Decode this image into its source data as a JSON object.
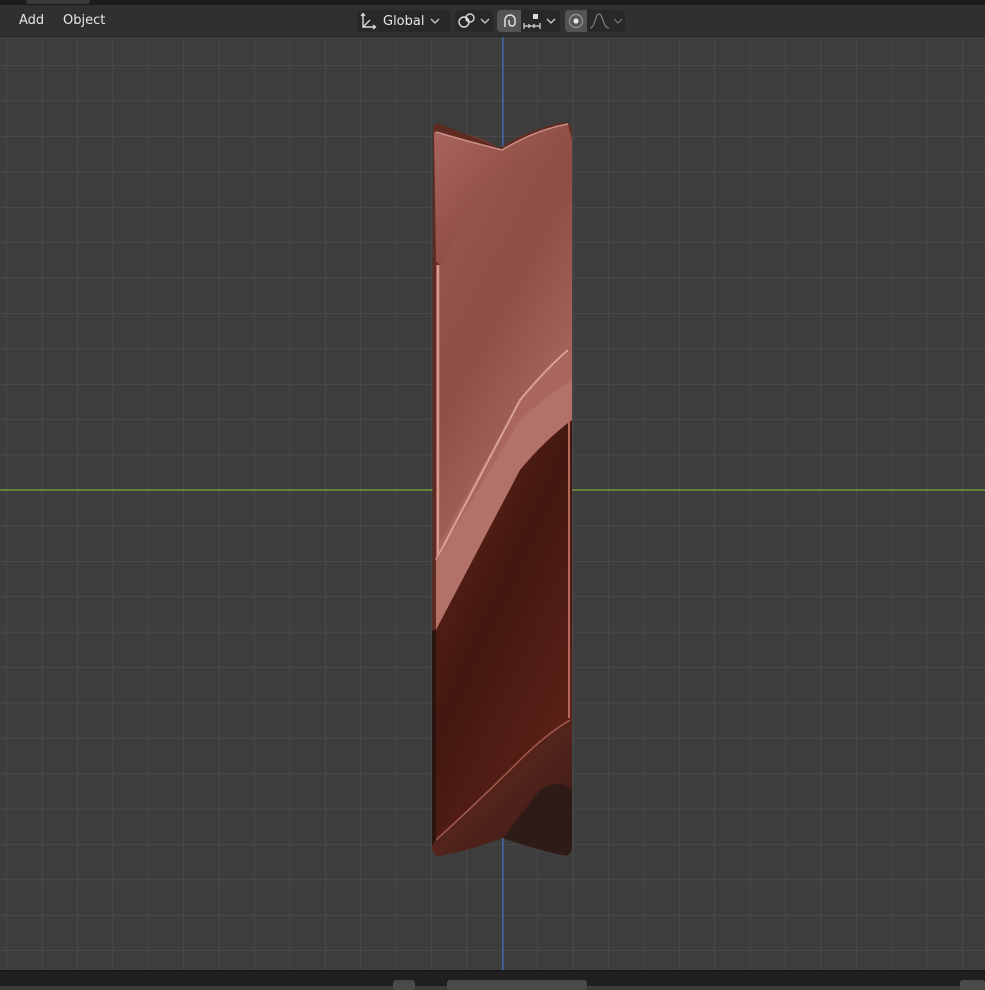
{
  "menu": {
    "add_label": "Add",
    "object_label": "Object"
  },
  "toolbar": {
    "transform_orientation": "Global",
    "pivot_icon": "pivot-point-icon",
    "snap_icon": "magnet-snap-icon",
    "snap_target_icon": "snap-increment-icon",
    "proportional_icon": "proportional-editing-icon",
    "falloff_icon": "falloff-curve-icon"
  },
  "viewport": {
    "object": "twisted-bar-mesh",
    "colors": {
      "background": "#3d3d3d",
      "grid": "#545454",
      "x_axis": "#7fa33a",
      "z_axis": "#3f6fbf",
      "mesh_light": "#b3736a",
      "mesh_dark": "#3a1610"
    }
  }
}
